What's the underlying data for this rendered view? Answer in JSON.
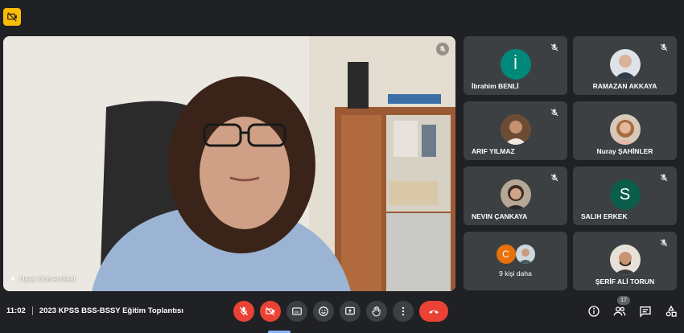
{
  "meeting": {
    "time": "11:02",
    "title": "2023 KPSS BSS-BSSY Eğitim Toplantısı"
  },
  "main_speaker": {
    "name": "Uşak Üniversitesi"
  },
  "participants": [
    {
      "name": "İbrahim BENLİ",
      "initial": "İ",
      "avatar_color": "#00897b",
      "kind": "initial"
    },
    {
      "name": "RAMAZAN AKKAYA",
      "kind": "photo",
      "photo_color": "#8d9aa6"
    },
    {
      "name": "ARIF YILMAZ",
      "kind": "photo",
      "photo_color": "#7b5a3c"
    },
    {
      "name": "Nuray ŞAHİNLER",
      "kind": "photo",
      "photo_color": "#c9935f"
    },
    {
      "name": "NEVIN ÇANKAYA",
      "kind": "photo",
      "photo_color": "#6f5a4a"
    },
    {
      "name": "SALIH ERKEK",
      "initial": "S",
      "avatar_color": "#0b5e4c",
      "kind": "initial"
    },
    {
      "name": "9 kişi daha",
      "initial": "C",
      "avatar_color": "#e8710a",
      "kind": "more"
    },
    {
      "name": "ŞERİF ALİ TORUN",
      "kind": "photo",
      "photo_color": "#4e4036"
    }
  ],
  "participant_count": "17",
  "icons": {
    "top_badge": "presentation-off-icon",
    "mic_off": "mic-off-icon",
    "cam_off": "camera-off-icon",
    "captions": "captions-icon",
    "emoji": "emoji-icon",
    "present": "present-screen-icon",
    "raise_hand": "raise-hand-icon",
    "more": "more-options-icon",
    "hangup": "hang-up-icon",
    "info": "info-icon",
    "people": "people-icon",
    "chat": "chat-icon",
    "activities": "activities-icon"
  },
  "colors": {
    "background": "#202124",
    "tile": "#3c4043",
    "danger": "#ea4335",
    "badge": "#fbbc04"
  }
}
